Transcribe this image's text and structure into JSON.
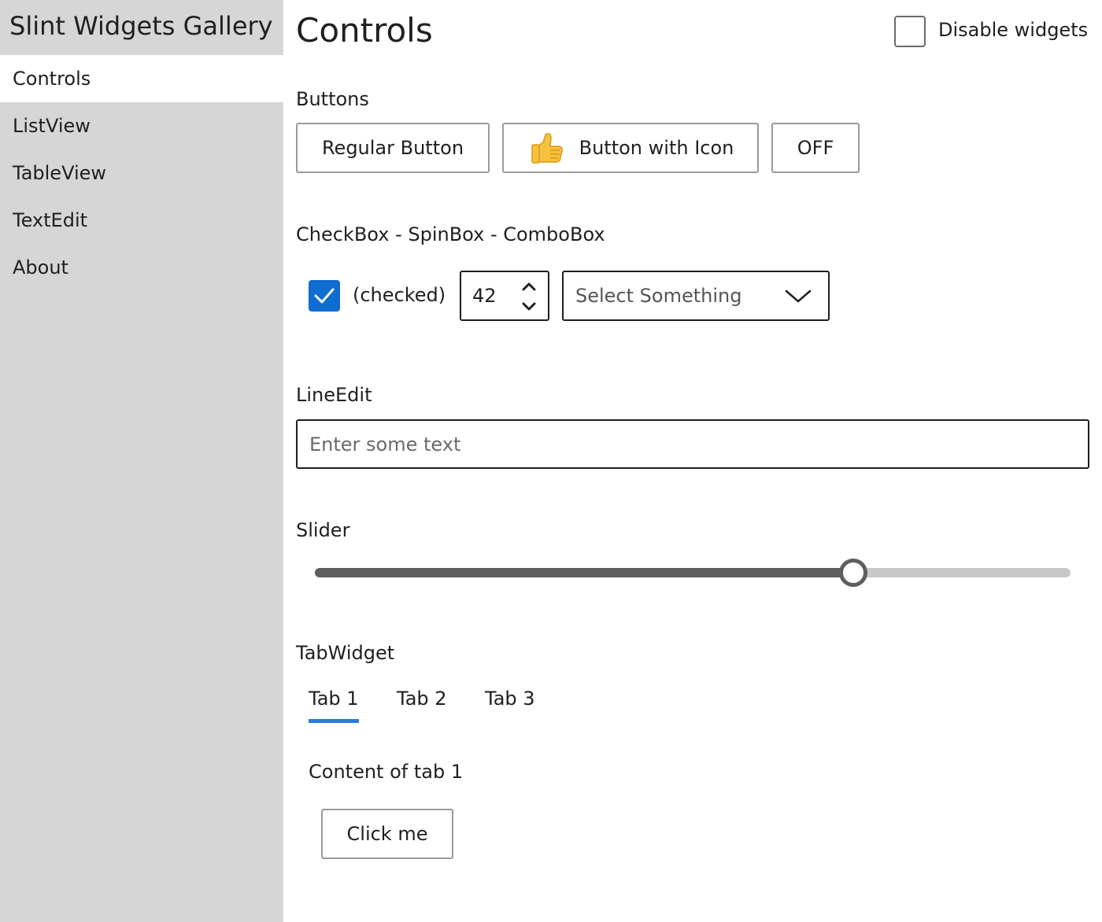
{
  "sidebar": {
    "title": "Slint Widgets Gallery",
    "items": [
      {
        "label": "Controls",
        "selected": true
      },
      {
        "label": "ListView",
        "selected": false
      },
      {
        "label": "TableView",
        "selected": false
      },
      {
        "label": "TextEdit",
        "selected": false
      },
      {
        "label": "About",
        "selected": false
      }
    ]
  },
  "header": {
    "title": "Controls",
    "disable_widgets": {
      "label": "Disable widgets",
      "checked": false
    }
  },
  "buttons_section": {
    "label": "Buttons",
    "regular_button": "Regular Button",
    "icon_button": {
      "label": "Button with Icon",
      "icon": "thumbs-up-icon"
    },
    "toggle_button": "OFF"
  },
  "inputs_section": {
    "label": "CheckBox - SpinBox - ComboBox",
    "checkbox": {
      "label": "(checked)",
      "checked": true
    },
    "spinbox": {
      "value": "42"
    },
    "combobox": {
      "value": "Select Something"
    }
  },
  "lineedit_section": {
    "label": "LineEdit",
    "placeholder": "Enter some text",
    "value": ""
  },
  "slider_section": {
    "label": "Slider",
    "value_fraction": 0.713
  },
  "tab_section": {
    "label": "TabWidget",
    "tabs": [
      {
        "label": "Tab 1",
        "selected": true
      },
      {
        "label": "Tab 2",
        "selected": false
      },
      {
        "label": "Tab 3",
        "selected": false
      }
    ],
    "content_text": "Content of tab 1",
    "content_button": "Click me"
  },
  "colors": {
    "accent": "#0f6cd0",
    "tab_indicator": "#2c7ad6",
    "sidebar_bg": "#d6d6d6",
    "slider_fill": "#5e5e5e",
    "slider_track": "#c8c8c8"
  }
}
